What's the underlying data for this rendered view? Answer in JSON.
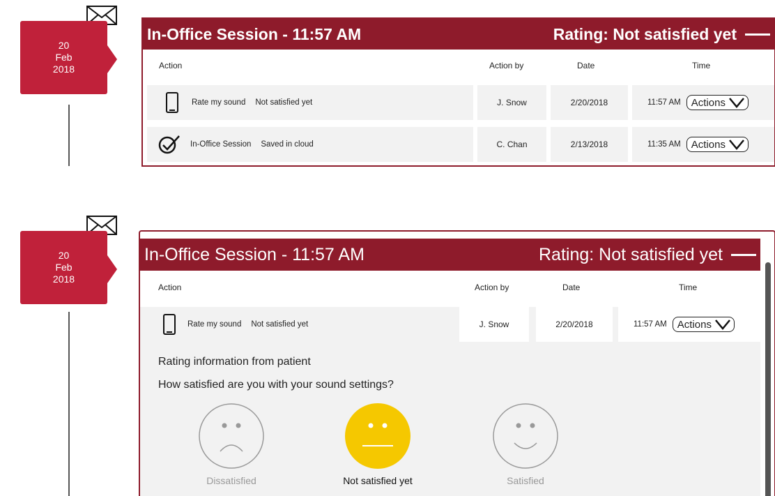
{
  "colors": {
    "accent": "#8e1b2b",
    "date_tag": "#c0213a",
    "neutral_face": "#f5c800",
    "row_bg": "#f2f2f2"
  },
  "entries": [
    {
      "date": {
        "day": "20",
        "month": "Feb",
        "year": "2018"
      },
      "header": {
        "title": "In-Office Session - 11:57 AM",
        "rating": "Rating: Not satisfied yet"
      },
      "columns": {
        "action": "Action",
        "action_by": "Action by",
        "date": "Date",
        "time": "Time"
      },
      "rows": [
        {
          "icon": "phone-icon",
          "action": "Rate my sound",
          "status": "Not satisfied yet",
          "by": "J. Snow",
          "date": "2/20/2018",
          "time": "11:57 AM",
          "button": "Actions"
        },
        {
          "icon": "check-circle-icon",
          "action": "In-Office Session",
          "status": "Saved in cloud",
          "by": "C. Chan",
          "date": "2/13/2018",
          "time": "11:35 AM",
          "button": "Actions"
        }
      ]
    },
    {
      "date": {
        "day": "20",
        "month": "Feb",
        "year": "2018"
      },
      "header": {
        "title": "In-Office Session - 11:57 AM",
        "rating": "Rating: Not satisfied yet"
      },
      "columns": {
        "action": "Action",
        "action_by": "Action by",
        "date": "Date",
        "time": "Time"
      },
      "rows": [
        {
          "icon": "phone-icon",
          "action": "Rate my sound",
          "status": "Not satisfied yet",
          "by": "J. Snow",
          "date": "2/20/2018",
          "time": "11:57 AM",
          "button": "Actions"
        }
      ],
      "detail": {
        "title": "Rating information from patient",
        "question": "How satisfied are you with your sound settings?",
        "options": [
          {
            "label": "Dissatisfied",
            "icon": "sad-face-icon",
            "selected": false
          },
          {
            "label": "Not satisfied yet",
            "icon": "neutral-face-icon",
            "selected": true
          },
          {
            "label": "Satisfied",
            "icon": "happy-face-icon",
            "selected": false
          }
        ]
      }
    }
  ]
}
